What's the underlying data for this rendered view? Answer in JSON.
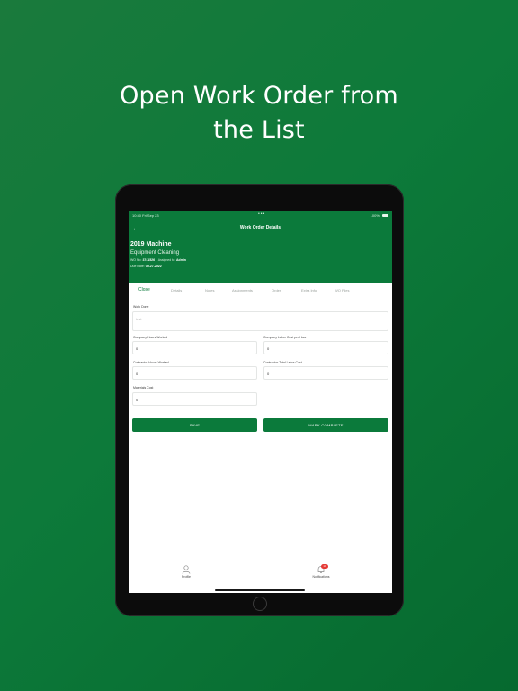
{
  "headline": {
    "line1": "Open Work Order from",
    "line2": "the List"
  },
  "status_bar": {
    "left": "10:30 Fri Sep 23",
    "center": "•••",
    "right": "100%"
  },
  "header": {
    "title": "Work Order Details",
    "wo_title": "2019 Machine",
    "wo_subtitle": "Equipment Cleaning",
    "wo_no_label": "WO No:",
    "wo_no": "3741526",
    "assigned_label": "Assigned to:",
    "assigned_to": "Admin",
    "due_label": "Due Date:",
    "due_date": "09-27-2022"
  },
  "tabs": [
    "Close",
    "Details",
    "Notes",
    "Assignments",
    "Order",
    "Extra Info",
    "WO Files"
  ],
  "form": {
    "work_done_label": "Work Done",
    "work_done_placeholder": "test",
    "company_hours_label": "Company Hours Worked",
    "company_hours_value": "0",
    "company_labor_cost_label": "Company Labor Cost per Hour",
    "company_labor_cost_value": "0",
    "contractor_hours_label": "Contractor Hours Worked",
    "contractor_hours_value": "0",
    "contractor_labor_cost_label": "Contractor Total Labor Cost",
    "contractor_labor_cost_value": "0",
    "materials_cost_label": "Materials Cost",
    "materials_cost_value": "0"
  },
  "buttons": {
    "save": "SAVE",
    "mark_complete": "MARK COMPLETE"
  },
  "bottom_nav": {
    "profile_label": "Profile",
    "notifications_label": "Notifications",
    "notifications_badge": "10"
  },
  "colors": {
    "brand_green": "#0b7a3b",
    "badge_red": "#e53935"
  }
}
